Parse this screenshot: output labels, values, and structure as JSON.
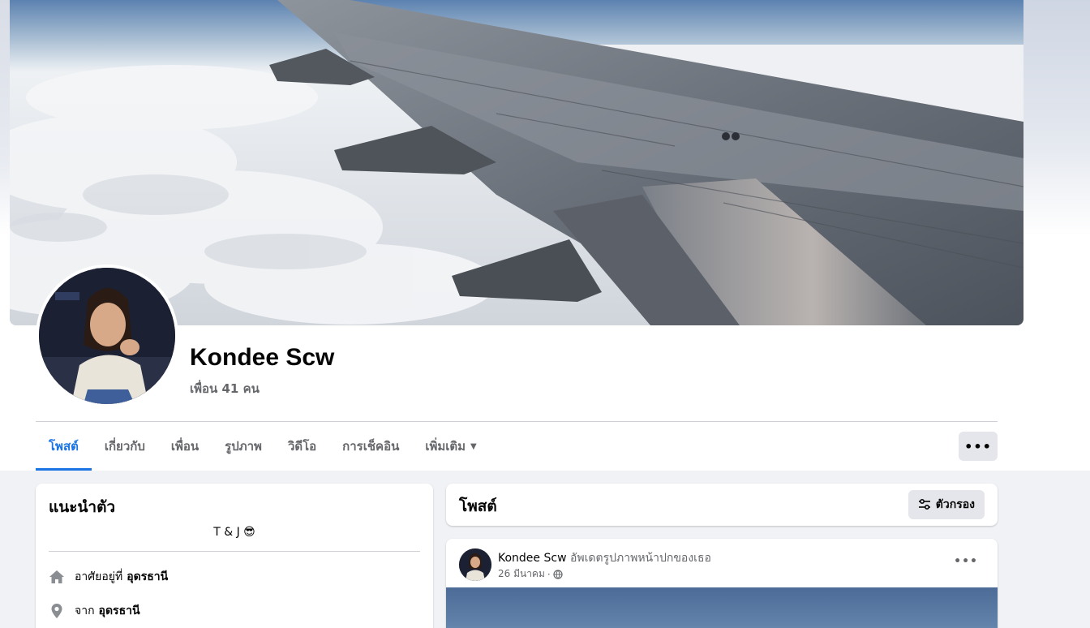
{
  "profile": {
    "name": "Kondee Scw",
    "friends": "เพื่อน 41 คน"
  },
  "tabs": [
    {
      "label": "โพสต์",
      "active": true
    },
    {
      "label": "เกี่ยวกับ"
    },
    {
      "label": "เพื่อน"
    },
    {
      "label": "รูปภาพ"
    },
    {
      "label": "วิดีโอ"
    },
    {
      "label": "การเช็คอิน"
    },
    {
      "label": "เพิ่มเติม",
      "caret": "▼"
    }
  ],
  "more_button": "•••",
  "intro": {
    "title": "แนะนำตัว",
    "bio": "T & J 😎",
    "lives_in_prefix": "อาศัยอยู่ที่",
    "lives_in": "อุดรธานี",
    "from_prefix": "จาก",
    "from": "อุดรธานี"
  },
  "posts": {
    "title": "โพสต์",
    "filter_label": "ตัวกรอง"
  },
  "post": {
    "author": "Kondee Scw",
    "action": "อัพเดตรูปภาพหน้าปกของเธอ",
    "date": "26 มีนาคม",
    "separator": "·",
    "more": "•••"
  },
  "colors": {
    "accent": "#1b74e4",
    "secondary_text": "#65676b",
    "button_bg": "#e4e6eb"
  }
}
